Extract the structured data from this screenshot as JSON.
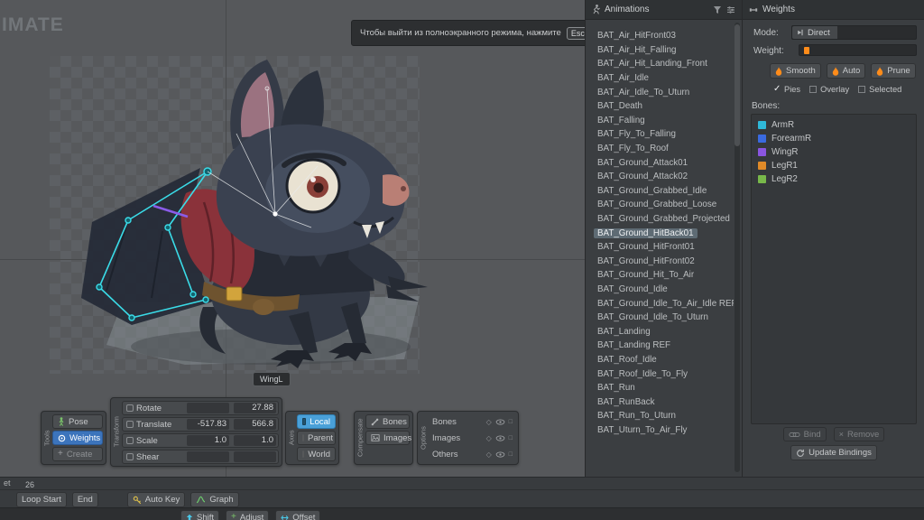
{
  "colors": {
    "selection_blue": "#3c74bc",
    "axis_local_cyan": "#4aa0d8",
    "flame_orange": "#ff8c1a",
    "skeleton_cyan": "#3adce8"
  },
  "viewport": {
    "watermark": "IMATE",
    "notification_text": "Чтобы выйти из полноэкранного режима, нажмите",
    "notification_key": "Esc",
    "tooltip": "WingL"
  },
  "animations_panel": {
    "tab": "Animations",
    "items": [
      {
        "label": "BAT_Air_HitFront03"
      },
      {
        "label": "BAT_Air_Hit_Falling"
      },
      {
        "label": "BAT_Air_Hit_Landing_Front"
      },
      {
        "label": "BAT_Air_Idle"
      },
      {
        "label": "BAT_Air_Idle_To_Uturn"
      },
      {
        "label": "BAT_Death"
      },
      {
        "label": "BAT_Falling"
      },
      {
        "label": "BAT_Fly_To_Falling"
      },
      {
        "label": "BAT_Fly_To_Roof"
      },
      {
        "label": "BAT_Ground_Attack01"
      },
      {
        "label": "BAT_Ground_Attack02"
      },
      {
        "label": "BAT_Ground_Grabbed_Idle"
      },
      {
        "label": "BAT_Ground_Grabbed_Loose"
      },
      {
        "label": "BAT_Ground_Grabbed_Projected"
      },
      {
        "label": "BAT_Ground_HitBack01",
        "selected": true
      },
      {
        "label": "BAT_Ground_HitFront01"
      },
      {
        "label": "BAT_Ground_HitFront02"
      },
      {
        "label": "BAT_Ground_Hit_To_Air"
      },
      {
        "label": "BAT_Ground_Idle"
      },
      {
        "label": "BAT_Ground_Idle_To_Air_Idle REF"
      },
      {
        "label": "BAT_Ground_Idle_To_Uturn"
      },
      {
        "label": "BAT_Landing"
      },
      {
        "label": "BAT_Landing REF"
      },
      {
        "label": "BAT_Roof_Idle"
      },
      {
        "label": "BAT_Roof_Idle_To_Fly"
      },
      {
        "label": "BAT_Run"
      },
      {
        "label": "BAT_RunBack"
      },
      {
        "label": "BAT_Run_To_Uturn"
      },
      {
        "label": "BAT_Uturn_To_Air_Fly"
      }
    ]
  },
  "weights_panel": {
    "tab": "Weights",
    "mode_label": "Mode:",
    "mode_value": "Direct",
    "weight_label": "Weight:",
    "smooth": "Smooth",
    "auto": "Auto",
    "prune": "Prune",
    "toggles": [
      {
        "label": "Pies",
        "checked": true
      },
      {
        "label": "Overlay",
        "checked": false
      },
      {
        "label": "Selected",
        "checked": false
      }
    ],
    "bones_label": "Bones:",
    "bones": [
      {
        "name": "ArmR",
        "color": "#2fb8d8"
      },
      {
        "name": "ForearmR",
        "color": "#3a6ae0"
      },
      {
        "name": "WingR",
        "color": "#8a55e0"
      },
      {
        "name": "LegR1",
        "color": "#e08a28"
      },
      {
        "name": "LegR2",
        "color": "#78b84a"
      }
    ],
    "bind": "Bind",
    "remove": "Remove",
    "update_bindings": "Update Bindings"
  },
  "tools_panel": {
    "label": "Tools",
    "buttons": [
      {
        "label": "Pose"
      },
      {
        "label": "Weights",
        "active": true
      },
      {
        "label": "Create"
      }
    ]
  },
  "transform_panel": {
    "label": "Transform",
    "rows": [
      {
        "name": "Rotate",
        "v1": "",
        "v2": "27.88"
      },
      {
        "name": "Translate",
        "v1": "-517.83",
        "v2": "566.8"
      },
      {
        "name": "Scale",
        "v1": "1.0",
        "v2": "1.0"
      },
      {
        "name": "Shear",
        "v1": "",
        "v2": ""
      }
    ]
  },
  "axes_panel": {
    "label": "Axes",
    "buttons": [
      {
        "label": "Local",
        "active": true
      },
      {
        "label": "Parent"
      },
      {
        "label": "World"
      }
    ]
  },
  "compensate_panel": {
    "label": "Compensate",
    "buttons": [
      {
        "label": "Bones"
      },
      {
        "label": "Images"
      }
    ]
  },
  "options_panel": {
    "label": "Options",
    "rows": [
      {
        "label": "Bones"
      },
      {
        "label": "Images"
      },
      {
        "label": "Others"
      }
    ]
  },
  "timeline": {
    "tab_fragment": "et",
    "frame": "26",
    "loop_start": "Loop Start",
    "end": "End",
    "auto_key": "Auto Key",
    "graph": "Graph"
  },
  "bottom_bar": {
    "buttons": [
      {
        "label": "Shift"
      },
      {
        "label": "Adjust"
      },
      {
        "label": "Offset"
      }
    ]
  }
}
